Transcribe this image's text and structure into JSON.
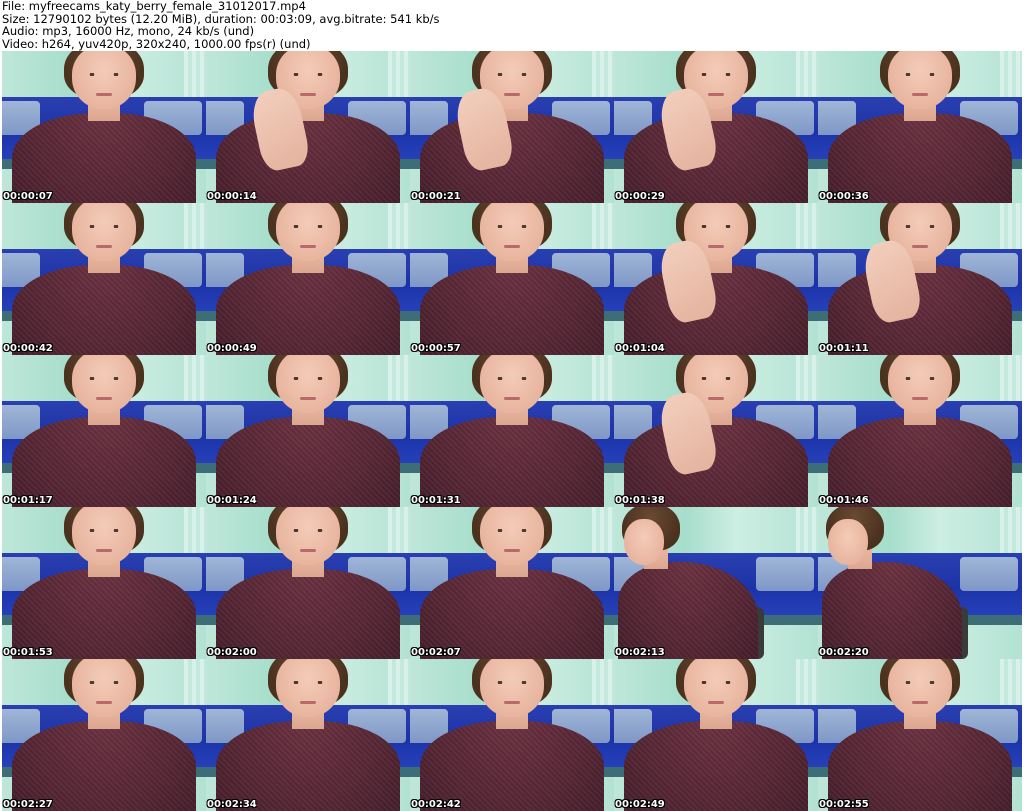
{
  "header": {
    "line1": "File: myfreecams_katy_berry_female_31012017.mp4",
    "line2": "Size: 12790102 bytes (12.20 MiB), duration: 00:03:09, avg.bitrate: 541 kb/s",
    "line3": "Audio: mp3, 16000 Hz, mono, 24 kb/s (und)",
    "line4": "Video: h264, yuv420p, 320x240, 1000.00 fps(r) (und)"
  },
  "thumbnails": [
    {
      "timestamp": "00:00:07",
      "pose": "front"
    },
    {
      "timestamp": "00:00:14",
      "pose": "hand"
    },
    {
      "timestamp": "00:00:21",
      "pose": "hand"
    },
    {
      "timestamp": "00:00:29",
      "pose": "hand"
    },
    {
      "timestamp": "00:00:36",
      "pose": "front"
    },
    {
      "timestamp": "00:00:42",
      "pose": "front"
    },
    {
      "timestamp": "00:00:49",
      "pose": "front"
    },
    {
      "timestamp": "00:00:57",
      "pose": "front"
    },
    {
      "timestamp": "00:01:04",
      "pose": "hand"
    },
    {
      "timestamp": "00:01:11",
      "pose": "hand"
    },
    {
      "timestamp": "00:01:17",
      "pose": "front"
    },
    {
      "timestamp": "00:01:24",
      "pose": "front"
    },
    {
      "timestamp": "00:01:31",
      "pose": "front"
    },
    {
      "timestamp": "00:01:38",
      "pose": "hand"
    },
    {
      "timestamp": "00:01:46",
      "pose": "front"
    },
    {
      "timestamp": "00:01:53",
      "pose": "front"
    },
    {
      "timestamp": "00:02:00",
      "pose": "front"
    },
    {
      "timestamp": "00:02:07",
      "pose": "front"
    },
    {
      "timestamp": "00:02:13",
      "pose": "side"
    },
    {
      "timestamp": "00:02:20",
      "pose": "side"
    },
    {
      "timestamp": "00:02:27",
      "pose": "front"
    },
    {
      "timestamp": "00:02:34",
      "pose": "front"
    },
    {
      "timestamp": "00:02:42",
      "pose": "front"
    },
    {
      "timestamp": "00:02:49",
      "pose": "front"
    },
    {
      "timestamp": "00:02:55",
      "pose": "front"
    }
  ]
}
